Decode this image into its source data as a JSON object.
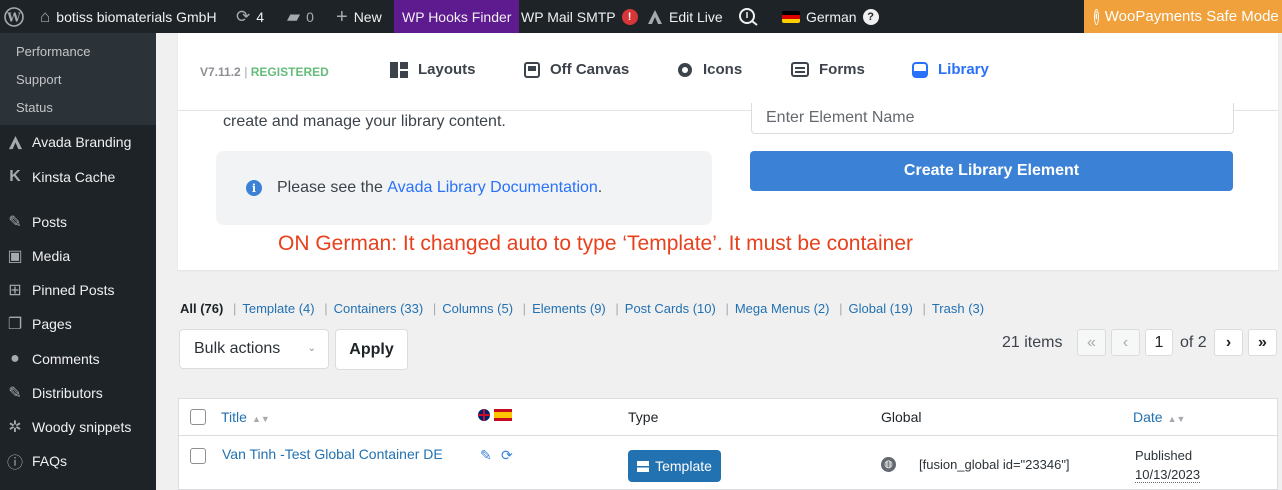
{
  "adminbar": {
    "site_name": "botiss biomaterials GmbH",
    "updates_count": "4",
    "comments_count": "0",
    "new_label": "New",
    "hooks_finder": "WP Hooks Finder",
    "mail_smtp": "WP Mail SMTP",
    "mail_smtp_badge": "!",
    "edit_live": "Edit Live",
    "language": "German",
    "language_badge": "?",
    "woopayments": "WooPayments Safe Mode"
  },
  "sidebar": {
    "submenu": [
      "Performance",
      "Support",
      "Status"
    ],
    "items": [
      {
        "label": "Avada Branding",
        "icon": "avada-icon"
      },
      {
        "label": "Kinsta Cache",
        "icon": "kinsta-icon"
      },
      {
        "label": "Posts",
        "icon": "pin-icon"
      },
      {
        "label": "Media",
        "icon": "media-icon"
      },
      {
        "label": "Pinned Posts",
        "icon": "grid-icon"
      },
      {
        "label": "Pages",
        "icon": "pages-icon"
      },
      {
        "label": "Comments",
        "icon": "comments-icon"
      },
      {
        "label": "Distributors",
        "icon": "pin-icon"
      },
      {
        "label": "Woody snippets",
        "icon": "snippets-icon"
      },
      {
        "label": "FAQs",
        "icon": "info-icon"
      }
    ]
  },
  "avada": {
    "version": "V7.11.2",
    "registered": "REGISTERED",
    "tabs": [
      {
        "label": "Layouts",
        "icon": "layouts-icon"
      },
      {
        "label": "Off Canvas",
        "icon": "off-canvas-icon"
      },
      {
        "label": "Icons",
        "icon": "icons-icon"
      },
      {
        "label": "Forms",
        "icon": "forms-icon"
      },
      {
        "label": "Library",
        "icon": "library-icon"
      }
    ],
    "active_tab": "Library"
  },
  "library": {
    "description": "create and manage your library content.",
    "element_name_placeholder": "Enter Element Name",
    "notice_prefix": "Please see the ",
    "notice_link": "Avada Library Documentation",
    "notice_suffix": ".",
    "create_button": "Create Library Element",
    "annotation": "ON German: It changed auto to type ‘Template’. It must be container"
  },
  "filters": {
    "all": "All (76)",
    "links": [
      "Template (4)",
      "Containers (33)",
      "Columns (5)",
      "Elements (9)",
      "Post Cards (10)",
      "Mega Menus (2)",
      "Global (19)",
      "Trash (3)"
    ]
  },
  "tablenav": {
    "bulk_actions": "Bulk actions",
    "apply": "Apply",
    "items_count": "21 items",
    "first": "«",
    "prev": "‹",
    "current_page": "1",
    "of_pages": "of 2",
    "next": "›",
    "last": "»"
  },
  "table": {
    "columns": {
      "title": "Title",
      "type": "Type",
      "global": "Global",
      "date": "Date"
    },
    "rows": [
      {
        "title": "Van Tinh -Test Global Container DE",
        "type": "Template",
        "global": "[fusion_global id=\"23346\"]",
        "status": "Published",
        "date": "10/13/2023"
      }
    ]
  },
  "colors": {
    "adminbar_bg": "#1d2327",
    "hooks_finder_bg": "#5e1a8f",
    "woopayments_bg": "#f0a13c",
    "primary_blue": "#3b82d6",
    "link_blue": "#2271b1",
    "annotation_red": "#e8401c"
  }
}
